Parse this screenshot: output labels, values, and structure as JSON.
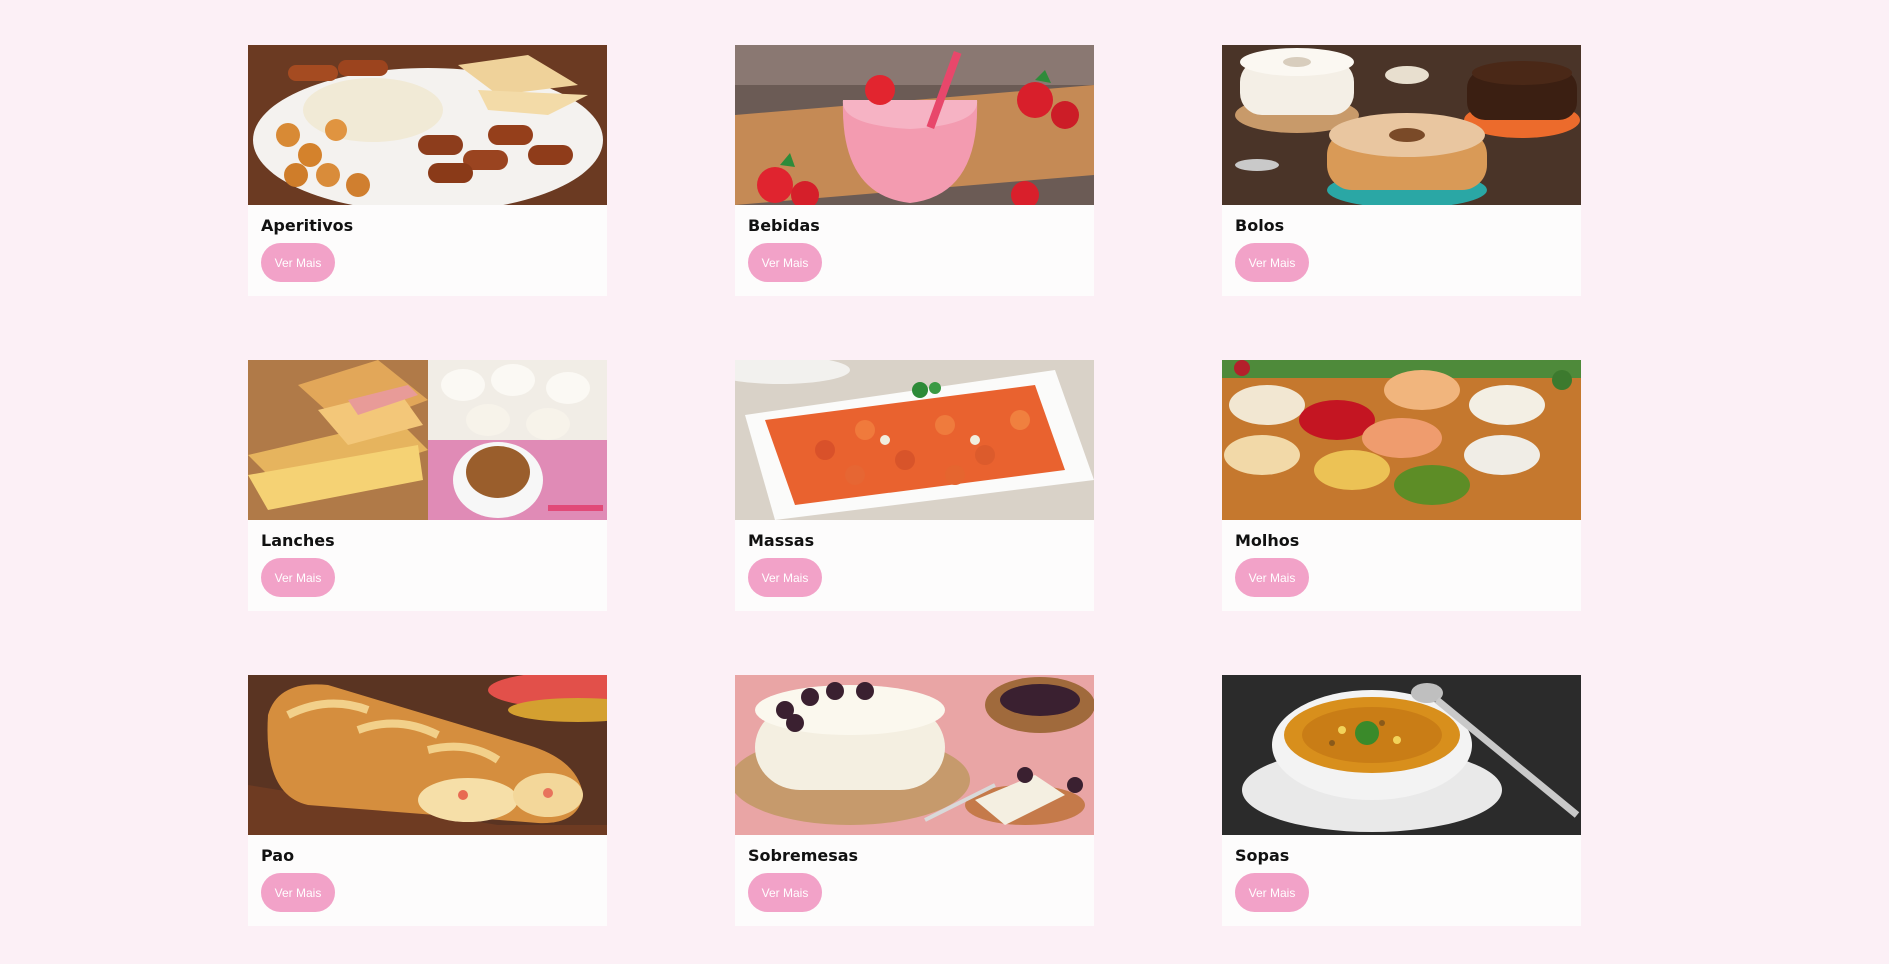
{
  "categories": [
    {
      "title": "Aperitivos",
      "button": "Ver Mais",
      "image": "fried-snacks-platter"
    },
    {
      "title": "Bebidas",
      "button": "Ver Mais",
      "image": "strawberry-smoothie"
    },
    {
      "title": "Bolos",
      "button": "Ver Mais",
      "image": "bundt-cakes"
    },
    {
      "title": "Lanches",
      "button": "Ver Mais",
      "image": "sandwiches-and-cookies"
    },
    {
      "title": "Massas",
      "button": "Ver Mais",
      "image": "pasta-dish"
    },
    {
      "title": "Molhos",
      "button": "Ver Mais",
      "image": "sauce-bowls"
    },
    {
      "title": "Pao",
      "button": "Ver Mais",
      "image": "stuffed-bread"
    },
    {
      "title": "Sobremesas",
      "button": "Ver Mais",
      "image": "pudding-dessert"
    },
    {
      "title": "Sopas",
      "button": "Ver Mais",
      "image": "soup-bowl"
    }
  ],
  "colors": {
    "background": "#fcf0f6",
    "card": "#fdfcfc",
    "button": "#f2a2c8",
    "button_text": "#ffffff"
  }
}
